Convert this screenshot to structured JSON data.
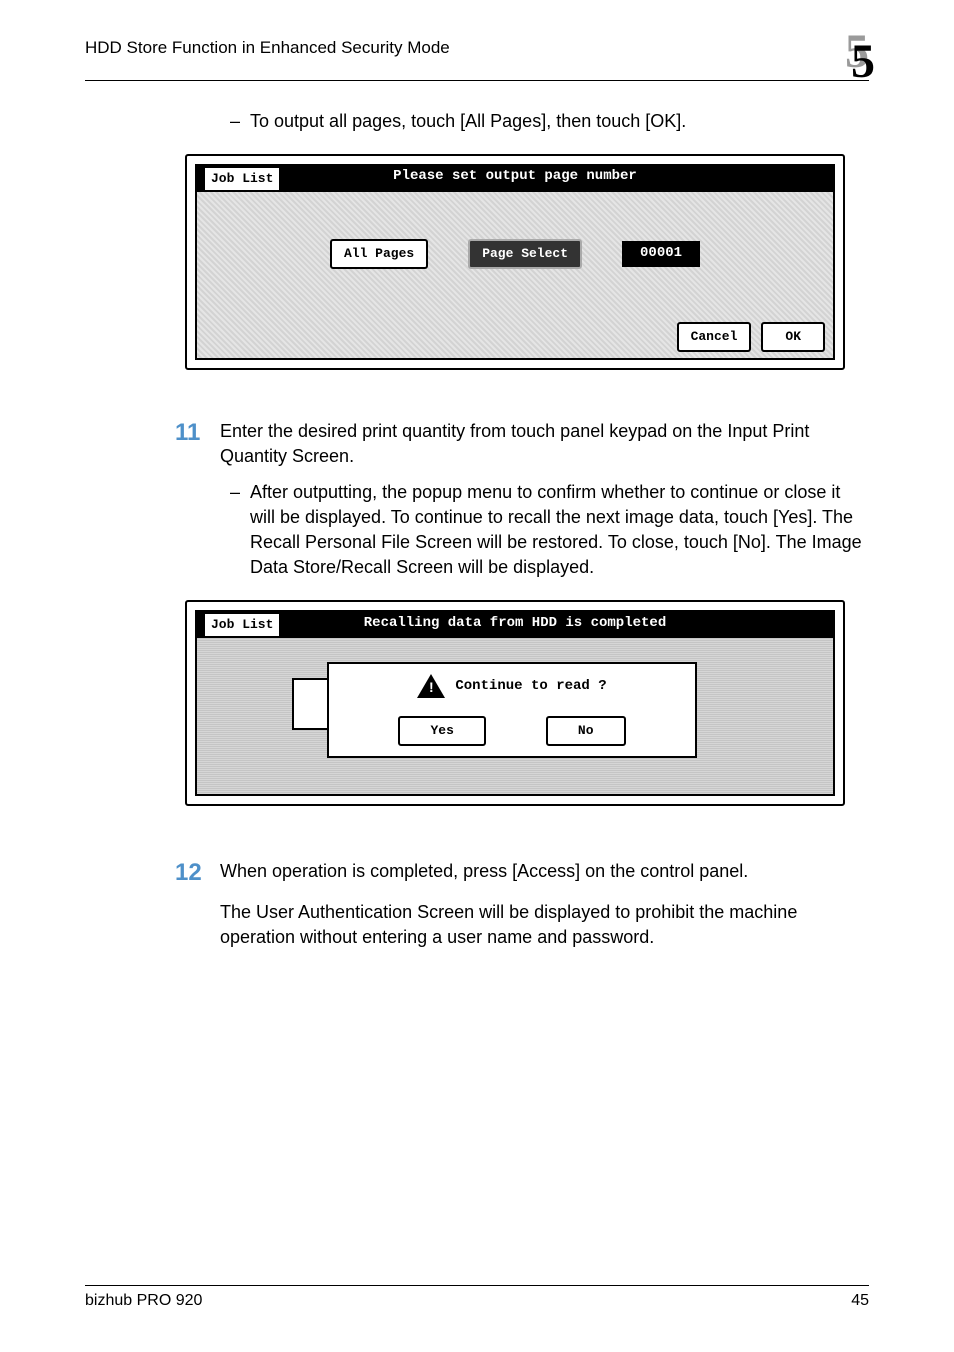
{
  "header": {
    "title": "HDD Store Function in Enhanced Security Mode",
    "chapter": "5"
  },
  "bullet_top": "To output all pages, touch [All Pages], then touch [OK].",
  "screenshot1": {
    "tab": "Job List",
    "title": "Please set output page number",
    "btn_all": "All Pages",
    "btn_page_select": "Page Select",
    "readout": "00001",
    "cancel": "Cancel",
    "ok": "OK"
  },
  "step11": {
    "num": "11",
    "text": "Enter the desired print quantity from touch panel keypad on the Input Print Quantity Screen.",
    "sub": "After outputting, the popup menu to confirm whether to continue or close it will be displayed. To continue to recall the next image data, touch [Yes]. The Recall Personal File Screen will be restored. To close, touch [No]. The Image Data Store/Recall Screen will be displayed."
  },
  "screenshot2": {
    "tab": "Job List",
    "title": "Recalling data from HDD is completed",
    "prompt": "Continue to read ?",
    "yes": "Yes",
    "no": "No"
  },
  "step12": {
    "num": "12",
    "text": "When operation is completed, press [Access] on the control panel.",
    "para2": "The User Authentication Screen will be displayed to prohibit the machine operation without entering a user name and password."
  },
  "footer": {
    "product": "bizhub PRO 920",
    "page": "45"
  }
}
